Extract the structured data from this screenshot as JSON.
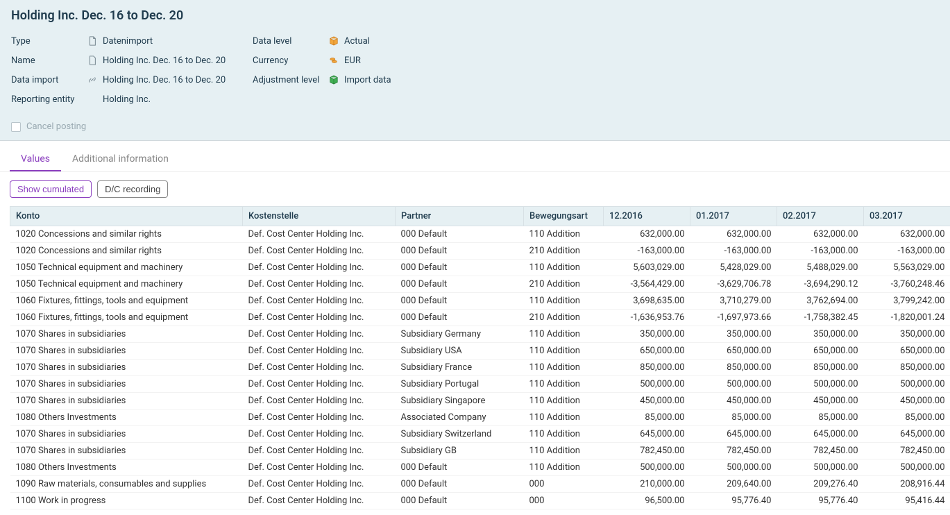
{
  "header": {
    "title": "Holding Inc. Dec. 16 to Dec. 20",
    "left": [
      {
        "label": "Type",
        "icon": "doc-icon",
        "value": "Datenimport"
      },
      {
        "label": "Name",
        "icon": "file-icon",
        "value": "Holding Inc. Dec. 16 to Dec. 20"
      },
      {
        "label": "Data import",
        "icon": "link-icon",
        "value": "Holding Inc. Dec. 16 to Dec. 20"
      },
      {
        "label": "Reporting entity",
        "icon": "",
        "value": "Holding Inc."
      }
    ],
    "right": [
      {
        "label": "Data level",
        "icon": "cube-orange-icon",
        "value": "Actual"
      },
      {
        "label": "Currency",
        "icon": "coins-icon",
        "value": "EUR"
      },
      {
        "label": "Adjustment level",
        "icon": "cube-green-icon",
        "value": "Import data"
      }
    ],
    "cancel_posting_label": "Cancel posting"
  },
  "tabs": [
    {
      "label": "Values",
      "active": true
    },
    {
      "label": "Additional information",
      "active": false
    }
  ],
  "toolbar": {
    "show_cumulated": "Show cumulated",
    "dc_recording": "D/C recording"
  },
  "table": {
    "columns": [
      "Konto",
      "Kostenstelle",
      "Partner",
      "Bewegungsart",
      "12.2016",
      "01.2017",
      "02.2017",
      "03.2017"
    ],
    "rows": [
      {
        "konto": "1020 Concessions and similar rights",
        "cost": "Def. Cost Center Holding Inc.",
        "partner": "000 Default",
        "move": "110 Addition",
        "v": [
          "632,000.00",
          "632,000.00",
          "632,000.00",
          "632,000.00"
        ]
      },
      {
        "konto": "1020 Concessions and similar rights",
        "cost": "Def. Cost Center Holding Inc.",
        "partner": "000 Default",
        "move": "210 Addition",
        "v": [
          "-163,000.00",
          "-163,000.00",
          "-163,000.00",
          "-163,000.00"
        ]
      },
      {
        "konto": "1050 Technical equipment and machinery",
        "cost": "Def. Cost Center Holding Inc.",
        "partner": "000 Default",
        "move": "110 Addition",
        "v": [
          "5,603,029.00",
          "5,428,029.00",
          "5,488,029.00",
          "5,563,029.00"
        ]
      },
      {
        "konto": "1050 Technical equipment and machinery",
        "cost": "Def. Cost Center Holding Inc.",
        "partner": "000 Default",
        "move": "210 Addition",
        "v": [
          "-3,564,429.00",
          "-3,629,706.78",
          "-3,694,290.12",
          "-3,760,248.46"
        ]
      },
      {
        "konto": "1060 Fixtures, fittings, tools and equipment",
        "cost": "Def. Cost Center Holding Inc.",
        "partner": "000 Default",
        "move": "110 Addition",
        "v": [
          "3,698,635.00",
          "3,710,279.00",
          "3,762,694.00",
          "3,799,242.00"
        ]
      },
      {
        "konto": "1060 Fixtures, fittings, tools and equipment",
        "cost": "Def. Cost Center Holding Inc.",
        "partner": "000 Default",
        "move": "210 Addition",
        "v": [
          "-1,636,953.76",
          "-1,697,973.66",
          "-1,758,382.45",
          "-1,820,001.24"
        ]
      },
      {
        "konto": "1070 Shares in subsidiaries",
        "cost": "Def. Cost Center Holding Inc.",
        "partner": "Subsidiary Germany",
        "move": "110 Addition",
        "v": [
          "350,000.00",
          "350,000.00",
          "350,000.00",
          "350,000.00"
        ]
      },
      {
        "konto": "1070 Shares in subsidiaries",
        "cost": "Def. Cost Center Holding Inc.",
        "partner": "Subsidiary USA",
        "move": "110 Addition",
        "v": [
          "650,000.00",
          "650,000.00",
          "650,000.00",
          "650,000.00"
        ]
      },
      {
        "konto": "1070 Shares in subsidiaries",
        "cost": "Def. Cost Center Holding Inc.",
        "partner": "Subsidiary France",
        "move": "110 Addition",
        "v": [
          "850,000.00",
          "850,000.00",
          "850,000.00",
          "850,000.00"
        ]
      },
      {
        "konto": "1070 Shares in subsidiaries",
        "cost": "Def. Cost Center Holding Inc.",
        "partner": "Subsidiary Portugal",
        "move": "110 Addition",
        "v": [
          "500,000.00",
          "500,000.00",
          "500,000.00",
          "500,000.00"
        ]
      },
      {
        "konto": "1070 Shares in subsidiaries",
        "cost": "Def. Cost Center Holding Inc.",
        "partner": "Subsidiary Singapore",
        "move": "110 Addition",
        "v": [
          "450,000.00",
          "450,000.00",
          "450,000.00",
          "450,000.00"
        ]
      },
      {
        "konto": "1080 Others Investments",
        "cost": "Def. Cost Center Holding Inc.",
        "partner": "Associated Company",
        "move": "110 Addition",
        "v": [
          "85,000.00",
          "85,000.00",
          "85,000.00",
          "85,000.00"
        ]
      },
      {
        "konto": "1070 Shares in subsidiaries",
        "cost": "Def. Cost Center Holding Inc.",
        "partner": "Subsidiary Switzerland",
        "move": "110 Addition",
        "v": [
          "645,000.00",
          "645,000.00",
          "645,000.00",
          "645,000.00"
        ]
      },
      {
        "konto": "1070 Shares in subsidiaries",
        "cost": "Def. Cost Center Holding Inc.",
        "partner": "Subsidiary GB",
        "move": "110 Addition",
        "v": [
          "782,450.00",
          "782,450.00",
          "782,450.00",
          "782,450.00"
        ]
      },
      {
        "konto": "1080 Others Investments",
        "cost": "Def. Cost Center Holding Inc.",
        "partner": "000 Default",
        "move": "110 Addition",
        "v": [
          "500,000.00",
          "500,000.00",
          "500,000.00",
          "500,000.00"
        ]
      },
      {
        "konto": "1090 Raw materials, consumables and supplies",
        "cost": "Def. Cost Center Holding Inc.",
        "partner": "000 Default",
        "move": "000",
        "v": [
          "210,000.00",
          "209,640.00",
          "209,276.40",
          "208,916.44"
        ]
      },
      {
        "konto": "1100 Work in progress",
        "cost": "Def. Cost Center Holding Inc.",
        "partner": "000 Default",
        "move": "000",
        "v": [
          "96,500.00",
          "95,776.40",
          "95,776.40",
          "95,416.44"
        ]
      }
    ]
  }
}
